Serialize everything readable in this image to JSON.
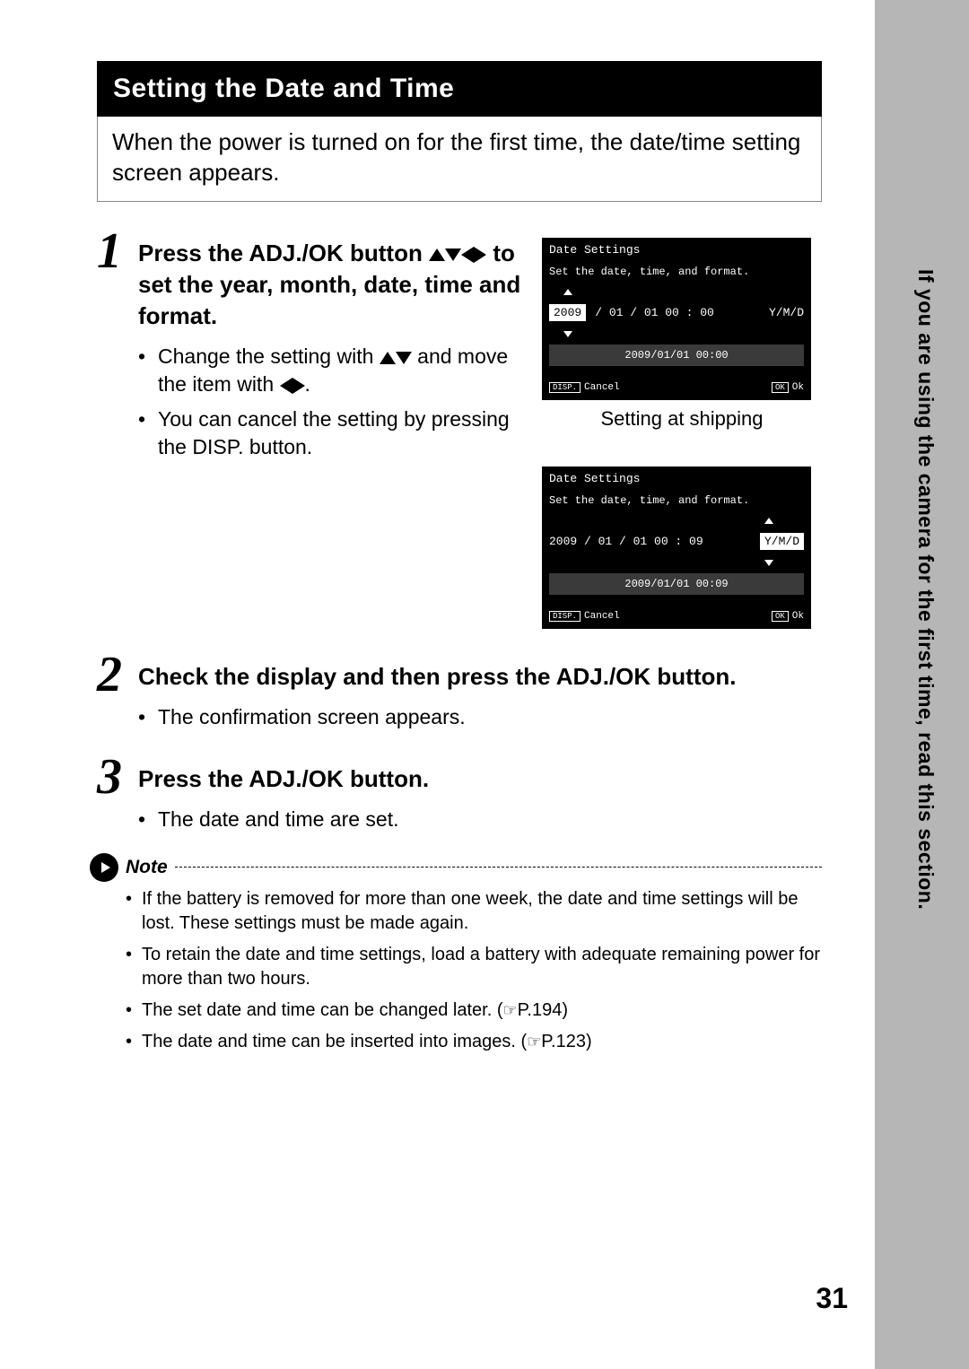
{
  "side_tab": "If you are using the camera for the first time, read this section.",
  "section_title": "Setting the Date and Time",
  "intro": "When the power is turned on for the first time, the date/time setting screen appears.",
  "steps": {
    "s1": {
      "num": "1",
      "head_a": "Press the ADJ./OK button",
      "head_b": "to set the year, month, date, time and format.",
      "bullet1_a": "Change the setting with",
      "bullet1_b": "and move the item with",
      "bullet1_c": ".",
      "bullet2": "You can cancel the setting by pressing the DISP. button."
    },
    "s2": {
      "num": "2",
      "head": "Check the display and then press the ADJ./OK button.",
      "bullet1": "The confirmation screen appears."
    },
    "s3": {
      "num": "3",
      "head": "Press the ADJ./OK button.",
      "bullet1": "The date and time are set."
    }
  },
  "lcd1": {
    "title": "Date Settings",
    "sub": "Set the date, time, and format.",
    "year": "2009",
    "rest": "/ 01 / 01    00 : 00",
    "fmt": "Y/M/D",
    "bar": "2009/01/01 00:00",
    "disp": "DISP.",
    "cancel": "Cancel",
    "ok_btn": "OK",
    "ok": "Ok"
  },
  "lcd1_caption": "Setting at shipping",
  "lcd2": {
    "title": "Date Settings",
    "sub": "Set the date, time, and format.",
    "date": "2009  / 01 / 01    00 : 09",
    "fmt": "Y/M/D",
    "bar": "2009/01/01 00:09",
    "disp": "DISP.",
    "cancel": "Cancel",
    "ok_btn": "OK",
    "ok": "Ok"
  },
  "note": {
    "label": "Note",
    "n1": "If the battery is removed for more than one week, the date and time settings will be lost. These settings must be made again.",
    "n2": "To retain the date and time settings, load a battery with adequate remaining power for more than two hours.",
    "n3_a": "The set date and time can be changed later. (",
    "n3_b": "P.194)",
    "n4_a": "The date and time can be inserted into images. (",
    "n4_b": "P.123)"
  },
  "page_number": "31"
}
